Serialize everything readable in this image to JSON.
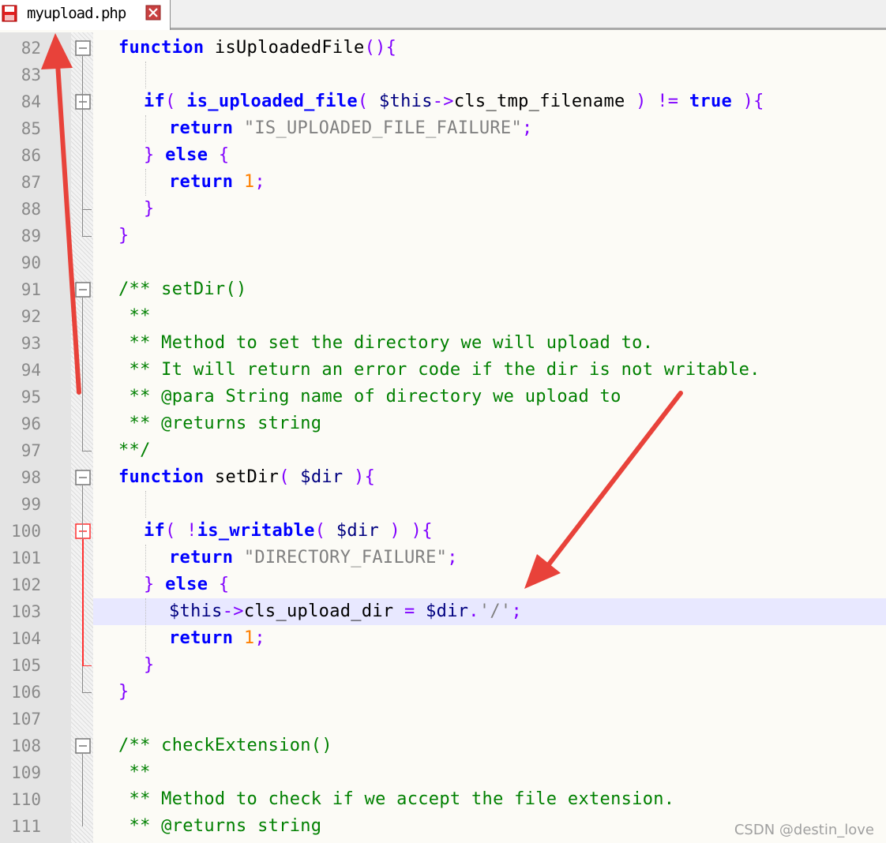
{
  "tab": {
    "filename": "myupload.php"
  },
  "lines": [
    {
      "n": "82",
      "indent": 0,
      "tokens": [
        [
          "kw",
          "function"
        ],
        [
          "plain",
          " isUploadedFile"
        ],
        [
          "op",
          "(){"
        ]
      ]
    },
    {
      "n": "83",
      "indent": 0,
      "tokens": []
    },
    {
      "n": "84",
      "indent": 1,
      "tokens": [
        [
          "kw",
          "if"
        ],
        [
          "op",
          "( "
        ],
        [
          "kw",
          "is_uploaded_file"
        ],
        [
          "op",
          "( "
        ],
        [
          "var",
          "$this"
        ],
        [
          "op",
          "->"
        ],
        [
          "plain",
          "cls_tmp_filename "
        ],
        [
          "op",
          ") != "
        ],
        [
          "kw",
          "true"
        ],
        [
          "op",
          " ){"
        ]
      ]
    },
    {
      "n": "85",
      "indent": 2,
      "tokens": [
        [
          "kw",
          "return"
        ],
        [
          "str",
          " \"IS_UPLOADED_FILE_FAILURE\""
        ],
        [
          "op",
          ";"
        ]
      ]
    },
    {
      "n": "86",
      "indent": 1,
      "tokens": [
        [
          "op",
          "} "
        ],
        [
          "kw",
          "else"
        ],
        [
          "op",
          " {"
        ]
      ]
    },
    {
      "n": "87",
      "indent": 2,
      "tokens": [
        [
          "kw",
          "return"
        ],
        [
          "num",
          " 1"
        ],
        [
          "op",
          ";"
        ]
      ]
    },
    {
      "n": "88",
      "indent": 1,
      "tokens": [
        [
          "op",
          "}"
        ]
      ]
    },
    {
      "n": "89",
      "indent": 0,
      "tokens": [
        [
          "op",
          "}"
        ]
      ]
    },
    {
      "n": "90",
      "indent": 0,
      "tokens": []
    },
    {
      "n": "91",
      "indent": 0,
      "tokens": [
        [
          "cm",
          "/** setDir()"
        ]
      ]
    },
    {
      "n": "92",
      "indent": 0,
      "tokens": [
        [
          "cm",
          " **"
        ]
      ]
    },
    {
      "n": "93",
      "indent": 0,
      "tokens": [
        [
          "cm",
          " ** Method to set the directory we will upload to."
        ]
      ]
    },
    {
      "n": "94",
      "indent": 0,
      "tokens": [
        [
          "cm",
          " ** It will return an error code if the dir is not writable."
        ]
      ]
    },
    {
      "n": "95",
      "indent": 0,
      "tokens": [
        [
          "cm",
          " ** @para String name of directory we upload to"
        ]
      ]
    },
    {
      "n": "96",
      "indent": 0,
      "tokens": [
        [
          "cm",
          " ** @returns string"
        ]
      ]
    },
    {
      "n": "97",
      "indent": 0,
      "tokens": [
        [
          "cm",
          "**/"
        ]
      ]
    },
    {
      "n": "98",
      "indent": 0,
      "tokens": [
        [
          "kw",
          "function"
        ],
        [
          "plain",
          " setDir"
        ],
        [
          "op",
          "( "
        ],
        [
          "var",
          "$dir"
        ],
        [
          "op",
          " ){"
        ]
      ]
    },
    {
      "n": "99",
      "indent": 0,
      "tokens": []
    },
    {
      "n": "100",
      "indent": 1,
      "tokens": [
        [
          "kw",
          "if"
        ],
        [
          "op",
          "( !"
        ],
        [
          "kw",
          "is_writable"
        ],
        [
          "op",
          "( "
        ],
        [
          "var",
          "$dir"
        ],
        [
          "op",
          " ) ){"
        ]
      ]
    },
    {
      "n": "101",
      "indent": 2,
      "tokens": [
        [
          "kw",
          "return"
        ],
        [
          "str",
          " \"DIRECTORY_FAILURE\""
        ],
        [
          "op",
          ";"
        ]
      ]
    },
    {
      "n": "102",
      "indent": 1,
      "tokens": [
        [
          "op",
          "} "
        ],
        [
          "kw",
          "else"
        ],
        [
          "op",
          " {"
        ]
      ]
    },
    {
      "n": "103",
      "indent": 2,
      "tokens": [
        [
          "var",
          "$this"
        ],
        [
          "op",
          "->"
        ],
        [
          "plain",
          "cls_upload_dir "
        ],
        [
          "op",
          "= "
        ],
        [
          "var",
          "$dir"
        ],
        [
          "op",
          "."
        ],
        [
          "str",
          "'/'"
        ],
        [
          "op",
          ";"
        ]
      ]
    },
    {
      "n": "104",
      "indent": 2,
      "tokens": [
        [
          "kw",
          "return"
        ],
        [
          "num",
          " 1"
        ],
        [
          "op",
          ";"
        ]
      ]
    },
    {
      "n": "105",
      "indent": 1,
      "tokens": [
        [
          "op",
          "}"
        ]
      ]
    },
    {
      "n": "106",
      "indent": 0,
      "tokens": [
        [
          "op",
          "}"
        ]
      ]
    },
    {
      "n": "107",
      "indent": 0,
      "tokens": []
    },
    {
      "n": "108",
      "indent": 0,
      "tokens": [
        [
          "cm",
          "/** checkExtension()"
        ]
      ]
    },
    {
      "n": "109",
      "indent": 0,
      "tokens": [
        [
          "cm",
          " **"
        ]
      ]
    },
    {
      "n": "110",
      "indent": 0,
      "tokens": [
        [
          "cm",
          " ** Method to check if we accept the file extension."
        ]
      ]
    },
    {
      "n": "111",
      "indent": 0,
      "tokens": [
        [
          "cm",
          " ** @returns string"
        ]
      ]
    }
  ],
  "highlight_line": "103",
  "watermark": "CSDN @destin_love",
  "colors": {
    "arrow": "#e8423a",
    "fold_active": "#ff3030",
    "highlight": "#e8e8ff"
  }
}
